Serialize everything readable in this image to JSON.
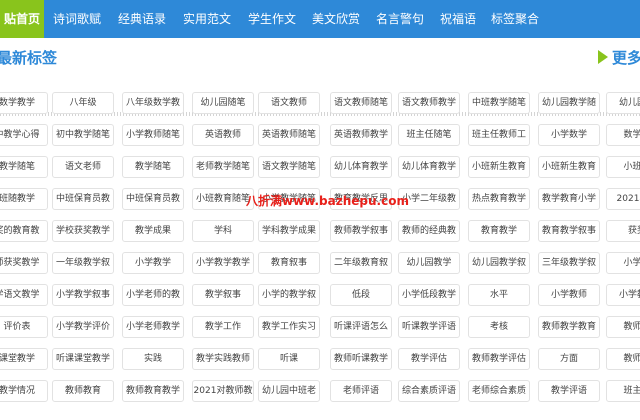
{
  "nav": {
    "items": [
      "贴首页",
      "诗词歌赋",
      "经典语录",
      "实用范文",
      "学生作文",
      "美文欣赏",
      "名言警句",
      "祝福语",
      "标签聚合"
    ],
    "active_index": 0
  },
  "section": {
    "title": "最新标签",
    "more_label": "更多"
  },
  "tag_rows": [
    [
      "数学教学",
      "八年级",
      "八年级数学教",
      "幼儿园随笔",
      "语文教师",
      "语文教师随笔",
      "语文教师教学",
      "中班教学随笔",
      "幼儿园教学随",
      "幼儿园中"
    ],
    [
      "中教学心得",
      "初中教学随笔",
      "小学教师随笔",
      "英语教师",
      "英语教师随笔",
      "英语教师教学",
      "班主任随笔",
      "班主任教师工",
      "小学数学",
      "数学教"
    ],
    [
      "教学随笔",
      "语文老师",
      "教学随笔",
      "老师教学随笔",
      "语文教学随笔",
      "幼儿体育教学",
      "幼儿体育教学",
      "小班新生教育",
      "小班新生教育",
      "小班随"
    ],
    [
      "班随教学",
      "中班保育员教",
      "中班保育员教",
      "小班教育随笔",
      "小学教学随笔",
      "教育教学反思",
      "小学二年级教",
      "热点教育教学",
      "教学教育小学",
      "2021小学"
    ],
    [
      "奖的教育教",
      "学校获奖教学",
      "教学成果",
      "学科",
      "学科教学成果",
      "教师教学叙事",
      "教师的经典教",
      "教育教学",
      "教育教学叙事",
      "获奖"
    ],
    [
      "师获奖教学",
      "一年级教学叙",
      "小学教学",
      "小学教学教学",
      "教育叙事",
      "二年级教育叙",
      "幼儿园教学",
      "幼儿园教学叙",
      "三年级教学叙",
      "小学语"
    ],
    [
      "学语文教学",
      "小学教学叙事",
      "小学老师的教",
      "教学叙事",
      "小学的教学叙",
      "低段",
      "小学低段教学",
      "水平",
      "小学教师",
      "小学教师"
    ],
    [
      "评价表",
      "小学教学评价",
      "小学老师教学",
      "教学工作",
      "教学工作实习",
      "听课评语怎么",
      "听课教学评语",
      "考核",
      "教师教学教育",
      "教师教"
    ],
    [
      "课堂教学",
      "听课课堂教学",
      "实践",
      "教学实践教师",
      "听课",
      "教师听课教学",
      "教学评估",
      "教师教学评估",
      "方面",
      "教师教"
    ],
    [
      "教学情况",
      "教师教育",
      "教师教育教学",
      "2021对教师教",
      "幼儿园中班老",
      "老师评语",
      "综合素质评语",
      "老师综合素质",
      "教学评语",
      "班主任"
    ]
  ],
  "watermark": "八折满www.bazhepu.com"
}
